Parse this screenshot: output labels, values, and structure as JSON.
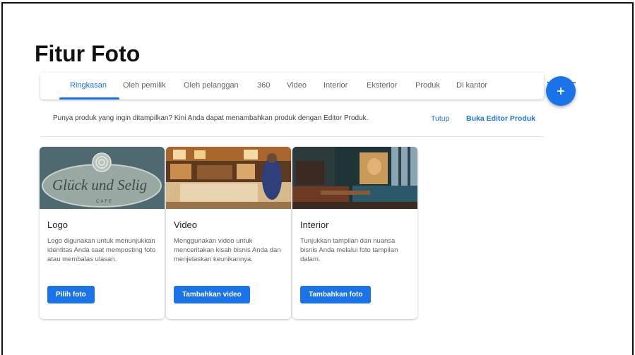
{
  "page": {
    "title": "Fitur Foto"
  },
  "tabs": [
    {
      "label": "Ringkasan"
    },
    {
      "label": "Oleh pemilik"
    },
    {
      "label": "Oleh pelanggan"
    },
    {
      "label": "360"
    },
    {
      "label": "Video"
    },
    {
      "label": "Interior"
    },
    {
      "label": "Eksterior"
    },
    {
      "label": "Produk"
    },
    {
      "label": "Di kantor"
    }
  ],
  "active_tab": "Ringkasan",
  "icons": {
    "next": "chevron-right-icon",
    "sort": "sort-icon",
    "add": "plus-icon"
  },
  "notice": {
    "text": "Punya produk yang ingin ditampilkan? Kini Anda dapat menambahkan produk dengan Editor Produk.",
    "close_label": "Tutup",
    "open_label": "Buka Editor Produk"
  },
  "cards": [
    {
      "title": "Logo",
      "description": "Logo digunakan untuk menunjukkan identitas Anda saat memposting foto atau membalas ulasan.",
      "button": "Pilih foto",
      "logo_text": "Glück und Selig",
      "logo_sub": "CAFE"
    },
    {
      "title": "Video",
      "description": "Menggunakan video untuk menceritakan kisah bisnis Anda dan menjelaskan keunikannya.",
      "button": "Tambahkan video"
    },
    {
      "title": "Interior",
      "description": "Tunjukkan tampilan dan nuansa bisnis Anda melalui foto tampilan dalam.",
      "button": "Tambahkan foto"
    }
  ],
  "colors": {
    "accent": "#1a73e8",
    "text": "#202124",
    "muted": "#5f6368"
  }
}
